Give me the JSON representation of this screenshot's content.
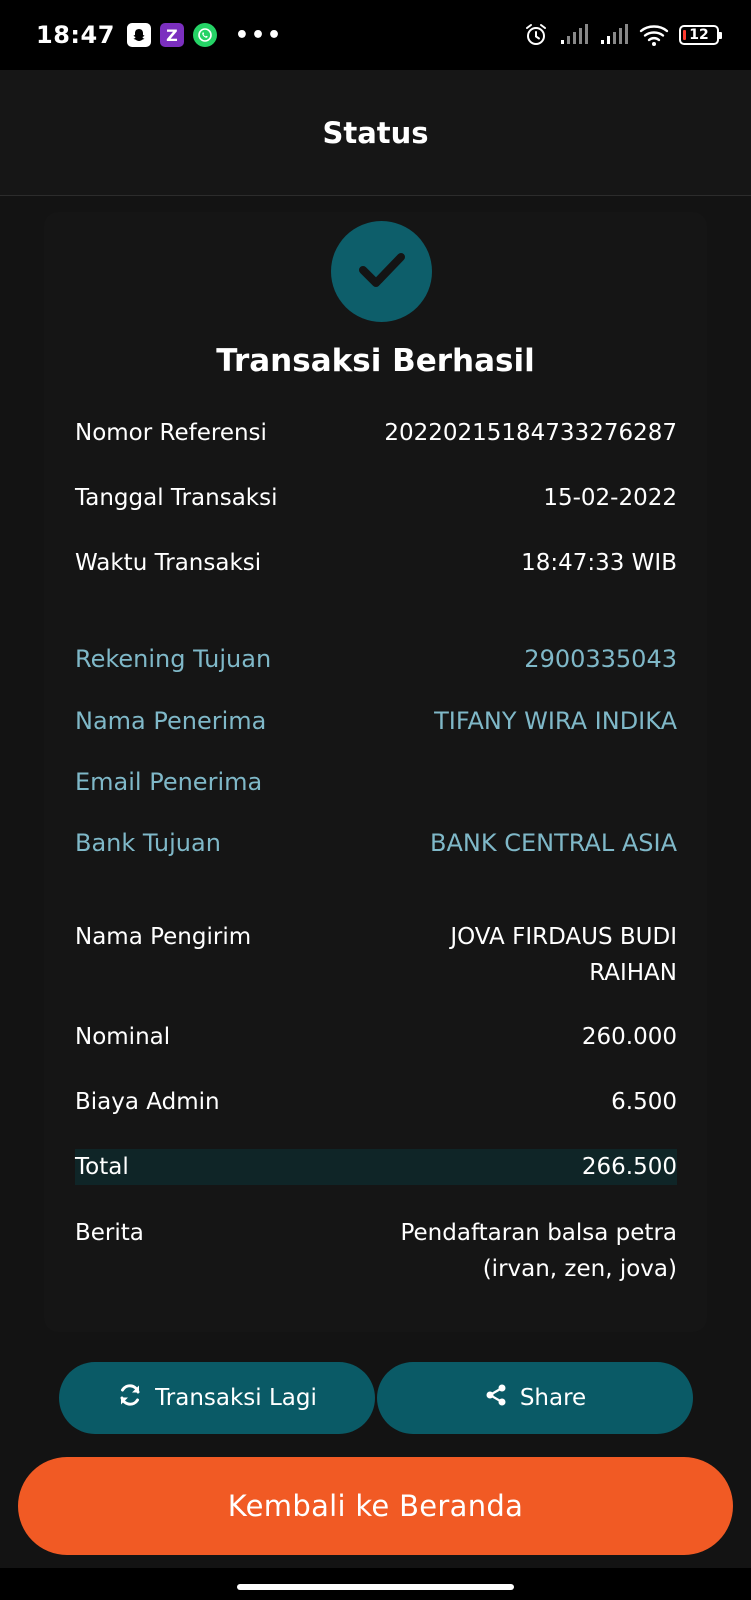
{
  "status_bar": {
    "time": "18:47",
    "battery": "12",
    "notification_icons": [
      "snapchat-icon",
      "zalo-icon",
      "whatsapp-icon"
    ],
    "more": "•••"
  },
  "header": {
    "title": "Status"
  },
  "status": {
    "icon": "check-icon",
    "title": "Transaksi Berhasil"
  },
  "details": [
    {
      "label": "Nomor Referensi",
      "value": "20220215184733276287"
    },
    {
      "label": "Tanggal Transaksi",
      "value": "15-02-2022"
    },
    {
      "label": "Waktu Transaksi",
      "value": "18:47:33 WIB"
    }
  ],
  "recipient": [
    {
      "label": "Rekening Tujuan",
      "value": "2900335043"
    },
    {
      "label": "Nama Penerima",
      "value": "TIFANY WIRA INDIKA"
    },
    {
      "label": "Email Penerima",
      "value": ""
    },
    {
      "label": "Bank Tujuan",
      "value": "BANK CENTRAL ASIA"
    }
  ],
  "sender": {
    "label": "Nama Pengirim",
    "value_line1": "JOVA FIRDAUS BUDI",
    "value_line2": "RAIHAN"
  },
  "amounts": [
    {
      "label": "Nominal",
      "value": "260.000"
    },
    {
      "label": "Biaya Admin",
      "value": "6.500"
    }
  ],
  "total": {
    "label": "Total",
    "value": "266.500"
  },
  "note": {
    "label": "Berita",
    "value_line1": "Pendaftaran balsa petra",
    "value_line2": "(irvan, zen, jova)"
  },
  "buttons": {
    "again": "Transaksi Lagi",
    "share": "Share",
    "home": "Kembali ke Beranda"
  },
  "colors": {
    "accent_teal": "#0d5e6a",
    "recipient_text": "#7fb8c8",
    "home_button": "#f15a24"
  }
}
